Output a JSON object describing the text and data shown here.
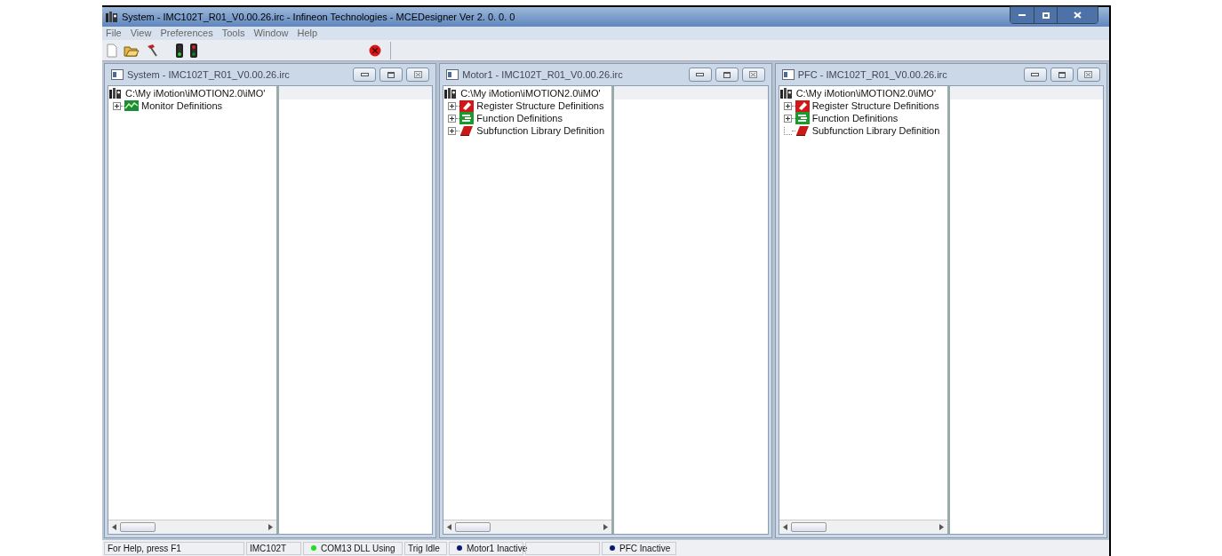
{
  "window": {
    "title": "System - IMC102T_R01_V0.00.26.irc - Infineon Technologies -  MCEDesigner Ver 2. 0. 0. 0"
  },
  "menu": [
    "File",
    "View",
    "Preferences",
    "Tools",
    "Window",
    "Help"
  ],
  "children": [
    {
      "title": "System - IMC102T_R01_V0.00.26.irc",
      "root": "C:\\My iMotion\\iMOTION2.0\\iMO'",
      "items": [
        {
          "label": "Monitor Definitions",
          "kind": "monitor",
          "expandable": true
        }
      ]
    },
    {
      "title": "Motor1 - IMC102T_R01_V0.00.26.irc",
      "root": "C:\\My iMotion\\iMOTION2.0\\iMO'",
      "items": [
        {
          "label": "Register Structure Definitions",
          "kind": "register",
          "expandable": true
        },
        {
          "label": "Function Definitions",
          "kind": "function",
          "expandable": true
        },
        {
          "label": "Subfunction Library Definition",
          "kind": "library",
          "expandable": true
        }
      ]
    },
    {
      "title": "PFC - IMC102T_R01_V0.00.26.irc",
      "root": "C:\\My iMotion\\iMOTION2.0\\iMO'",
      "items": [
        {
          "label": "Register Structure Definitions",
          "kind": "register",
          "expandable": true
        },
        {
          "label": "Function Definitions",
          "kind": "function",
          "expandable": true
        },
        {
          "label": "Subfunction Library Definition",
          "kind": "library",
          "expandable": false
        }
      ]
    }
  ],
  "status_bar": [
    {
      "kind": "text",
      "text": "For Help, press F1"
    },
    {
      "kind": "text",
      "text": "IMC102T"
    },
    {
      "kind": "dot",
      "text": "COM13 DLL Using",
      "color": "#22dd22"
    },
    {
      "kind": "text",
      "text": "Trig Idle"
    },
    {
      "kind": "dot",
      "text": "Motor1 Inactive",
      "color": "#0a1a70"
    },
    {
      "kind": "blank"
    },
    {
      "kind": "dot",
      "text": "PFC Inactive",
      "color": "#0a1a70"
    }
  ]
}
